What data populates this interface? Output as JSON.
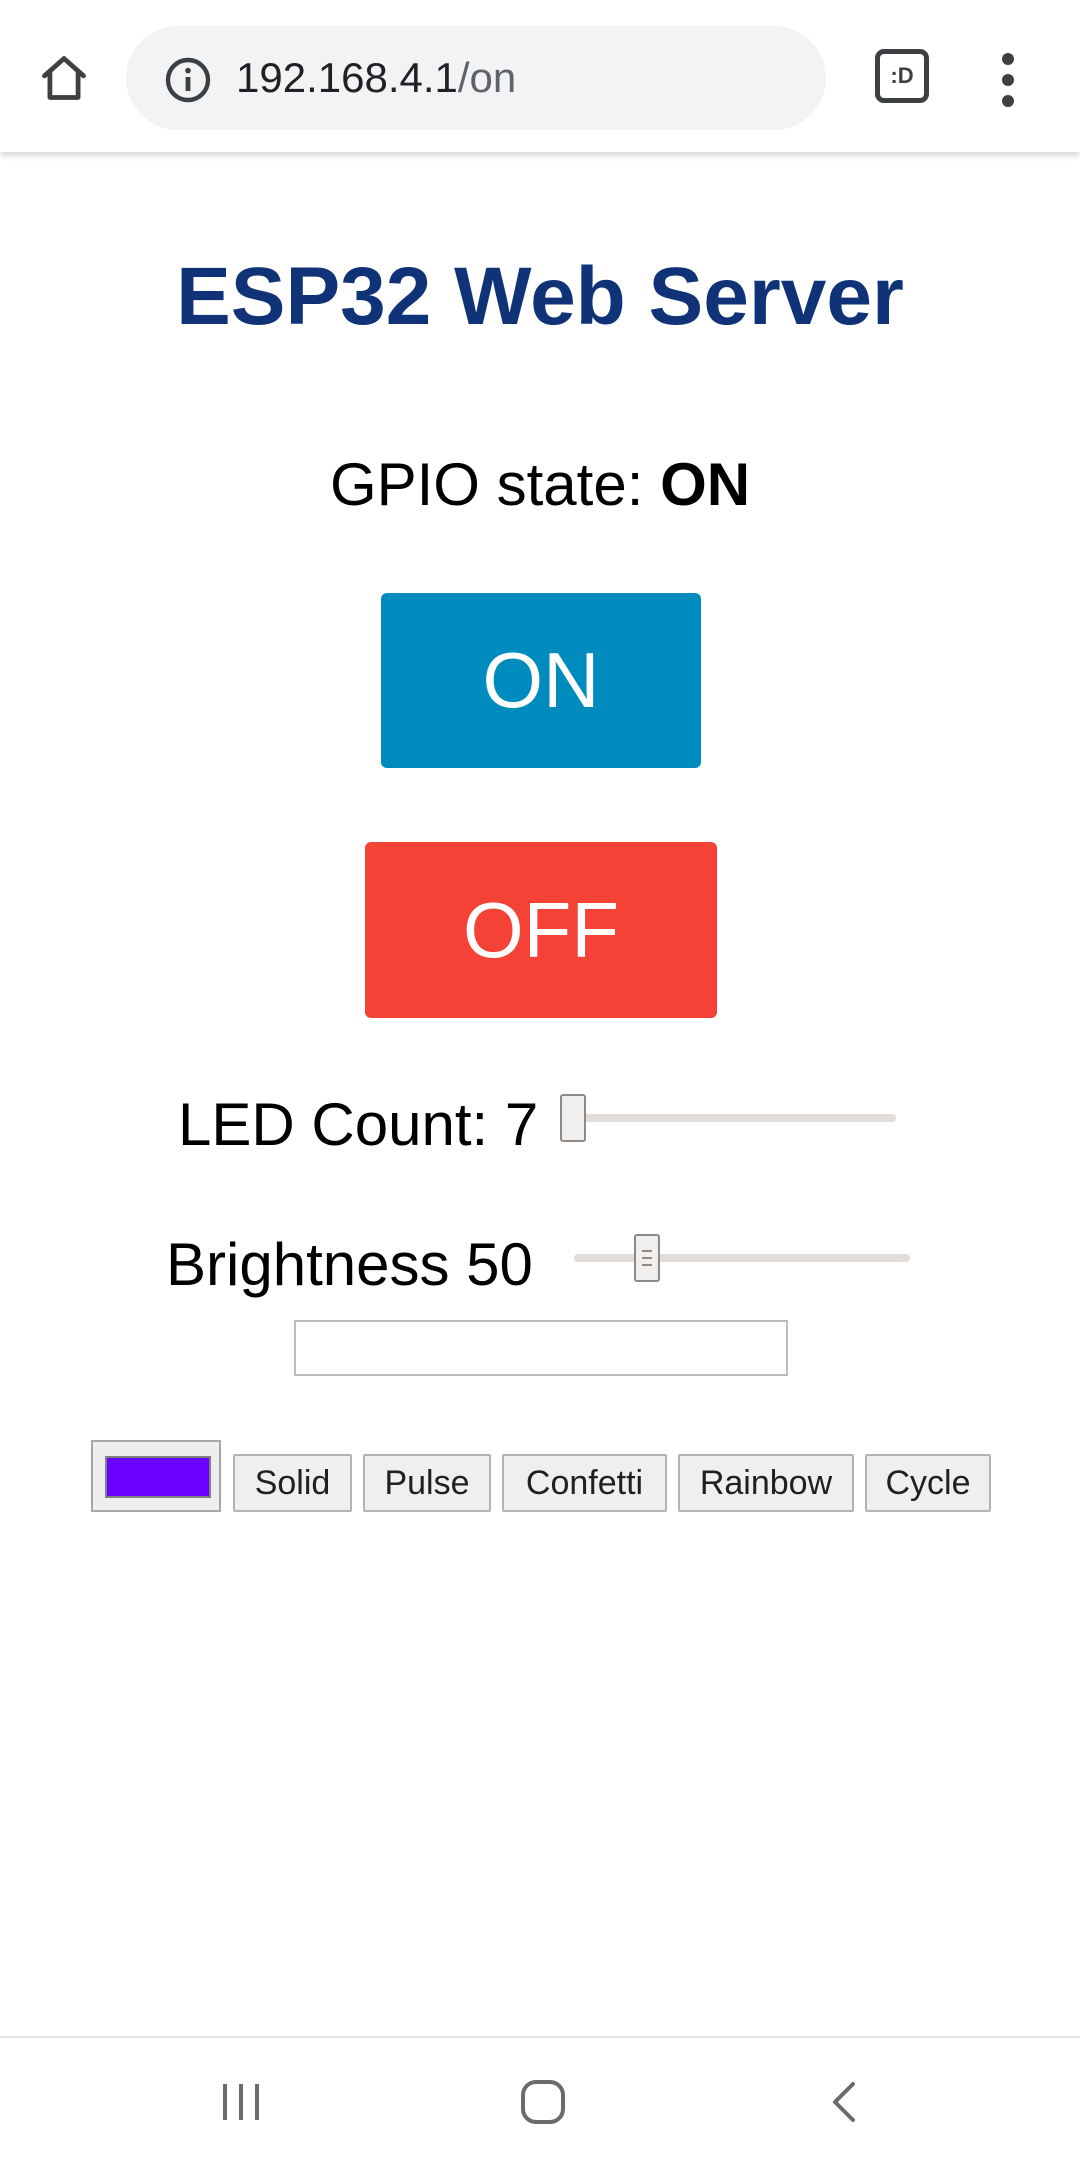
{
  "browser": {
    "url_host": "192.168.4.1",
    "url_path": "/on",
    "tab_switcher_label": ":D",
    "icons": {
      "home": "home-icon",
      "info": "info-icon",
      "tabs": "tab-switcher-icon",
      "menu": "more-vert-icon"
    }
  },
  "page": {
    "title": "ESP32 Web Server",
    "title_color": "#0f3376",
    "gpio_label": "GPIO state: ",
    "gpio_value": "ON",
    "on_button": "ON",
    "on_color": "#008bbf",
    "off_button": "OFF",
    "off_color": "#f44336",
    "led_count": {
      "label": "LED Count: ",
      "value": "7",
      "position": 0.0
    },
    "brightness": {
      "label": "Brightness ",
      "value": "50",
      "position": 0.2
    },
    "text_input": {
      "value": "",
      "placeholder": ""
    },
    "color_picker": {
      "value": "#6a00ff"
    },
    "modes": [
      "Solid",
      "Pulse",
      "Confetti",
      "Rainbow",
      "Cycle"
    ]
  },
  "navbar": {
    "icons": {
      "recents": "recents-icon",
      "home": "android-home-icon",
      "back": "back-icon"
    }
  }
}
